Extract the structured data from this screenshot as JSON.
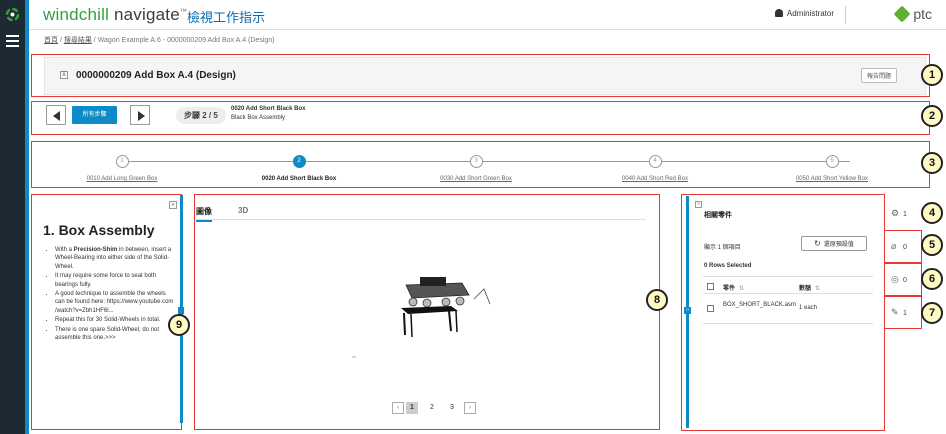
{
  "brand": {
    "name_part1": "windchill",
    "name_part2": " navigate",
    "tm": "™",
    "app_title": "檢視工作指示"
  },
  "header": {
    "user": "Administrator",
    "vendor": "ptc"
  },
  "breadcrumb": {
    "home": "首頁",
    "search": "搜尋結果",
    "sep": " / ",
    "current": "Wagon Example A.6 - 0000000209 Add Box A.4 (Design)"
  },
  "document": {
    "title": "0000000209 Add Box A.4 (Design)",
    "report_button": "報告問題"
  },
  "stepbar": {
    "all_steps": "所有步驟",
    "step_counter": "步驟 2 / 5",
    "step_name": "0020 Add Short Black Box",
    "step_subtitle": "Black Box Assembly"
  },
  "progress": {
    "steps": [
      {
        "num": "1",
        "label": "0010 Add Long Green Box"
      },
      {
        "num": "2",
        "label": "0020 Add Short Black Box"
      },
      {
        "num": "3",
        "label": "0030 Add Short Green Box"
      },
      {
        "num": "4",
        "label": "0040 Add Short Red Box"
      },
      {
        "num": "5",
        "label": "0050 Add Short Yellow Box"
      }
    ],
    "active_index": 1
  },
  "instructions": {
    "collapse_icon": "«",
    "title": "1. Box Assembly",
    "bullets": [
      {
        "pre": "With a ",
        "bold": "Precision-Shim",
        "post": " in between, insert a Wheel-Bearing into either side of the Solid-Wheel."
      },
      {
        "pre": "It may require some force to seat both bearings fully.",
        "bold": "",
        "post": ""
      },
      {
        "pre": "A good technique to assemble the wheels can be found here: https://www.youtube.com /watch?v=Zbh1HF6l...",
        "bold": "",
        "post": ""
      },
      {
        "pre": "Repeat this for 30 Solid-Wheels in total.",
        "bold": "",
        "post": ""
      },
      {
        "pre": "There is one spare Solid-Wheel, do not assemble this one.>>>",
        "bold": "",
        "post": ""
      }
    ]
  },
  "viewer": {
    "tabs": [
      {
        "label": "圖像"
      },
      {
        "label": "3D"
      }
    ],
    "pages": [
      "1",
      "2",
      "3"
    ],
    "current_page": "1"
  },
  "related_parts": {
    "collapse_icon": "»",
    "title": "相關零件",
    "display_count": "顯示 1 個項目",
    "reset_button": "還原預設值",
    "selected": "0 Rows Selected",
    "columns": {
      "part": "零件",
      "quantity": "數額"
    },
    "rows": [
      {
        "part": "BOX_SHORT_BLACK.asm",
        "quantity": "1 each"
      }
    ]
  },
  "side_rail": {
    "items": [
      {
        "icon": "gear-icon",
        "count": "1"
      },
      {
        "icon": "paperclip-icon",
        "count": "0"
      },
      {
        "icon": "target-icon",
        "count": "0"
      },
      {
        "icon": "wrench-icon",
        "count": "1"
      }
    ]
  },
  "annotations": [
    "1",
    "2",
    "3",
    "4",
    "5",
    "6",
    "7",
    "8",
    "9"
  ],
  "colors": {
    "accent": "#0e8bc6",
    "brand_green": "#36a041",
    "annotation_red": "#e53935",
    "annotation_fill": "#fff9c4",
    "nav_dark": "#1e2a33"
  }
}
